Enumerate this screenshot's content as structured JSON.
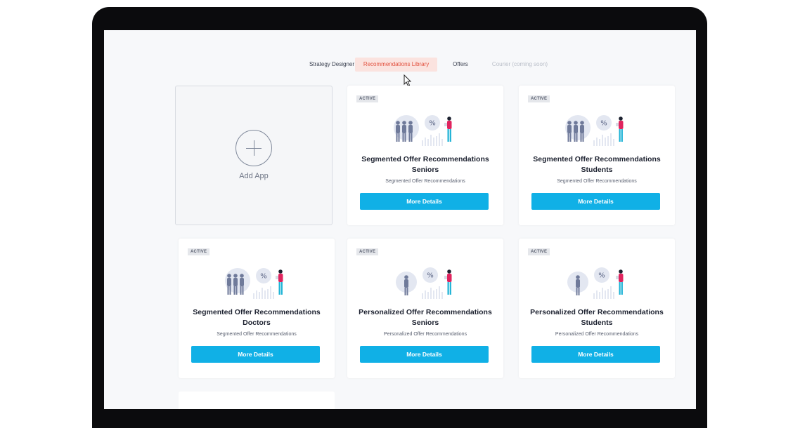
{
  "nav": {
    "tabs": [
      {
        "label": "Strategy Designer",
        "state": "normal"
      },
      {
        "label": "Recommendations Library",
        "state": "active"
      },
      {
        "label": "Offers",
        "state": "normal"
      },
      {
        "label": "Courier (coming soon)",
        "state": "disabled"
      }
    ]
  },
  "add_card": {
    "label": "Add App"
  },
  "cards": [
    {
      "badge": "ACTIVE",
      "title": "Segmented Offer Recommendations Seniors",
      "subtitle": "Segmented Offer Recommendations",
      "button": "More Details",
      "illustration": "group-people-percent-icon"
    },
    {
      "badge": "ACTIVE",
      "title": "Segmented Offer Recommendations Students",
      "subtitle": "Segmented Offer Recommendations",
      "button": "More Details",
      "illustration": "group-people-percent-icon"
    },
    {
      "badge": "ACTIVE",
      "title": "Segmented Offer Recommendations Doctors",
      "subtitle": "Segmented Offer Recommendations",
      "button": "More Details",
      "illustration": "group-people-percent-icon"
    },
    {
      "badge": "ACTIVE",
      "title": "Personalized Offer Recommendations Seniors",
      "subtitle": "Personalized Offer Recommendations",
      "button": "More Details",
      "illustration": "single-person-percent-icon"
    },
    {
      "badge": "ACTIVE",
      "title": "Personalized Offer Recommendations Students",
      "subtitle": "Personalized Offer Recommendations",
      "button": "More Details",
      "illustration": "single-person-percent-icon"
    }
  ],
  "colors": {
    "accent": "#10b0e6",
    "active_tab_bg": "#fbe3df",
    "active_tab_text": "#e2513f",
    "figure": "#6f7a9a",
    "person_shirt": "#e0245e",
    "person_pants": "#1fb3d6"
  }
}
